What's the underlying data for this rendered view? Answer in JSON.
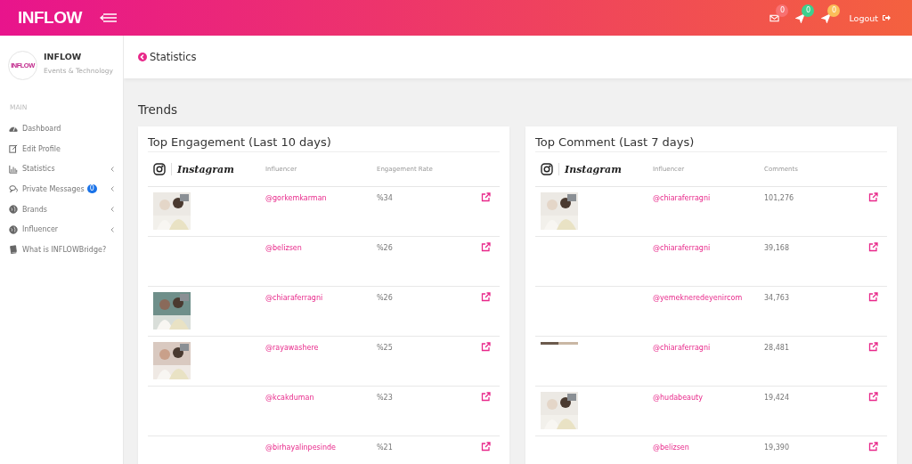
{
  "header": {
    "logo": "INFLOW",
    "notifications": [
      {
        "kind": "mail",
        "count": "0",
        "color": "#f87171"
      },
      {
        "kind": "send",
        "count": "0",
        "color": "#3ecf8e"
      },
      {
        "kind": "send",
        "count": "0",
        "color": "#fbbf5a"
      }
    ],
    "logout": "Logout"
  },
  "sidebar": {
    "profile": {
      "name": "INFLOW",
      "subtitle": "Events & Technology",
      "avatar_text": "INFLOW"
    },
    "section": "MAIN",
    "items": [
      {
        "label": "Dashboard",
        "kind": "dashboard",
        "has_submenu": false
      },
      {
        "label": "Edit Profile",
        "kind": "edit",
        "has_submenu": false
      },
      {
        "label": "Statistics",
        "kind": "chart",
        "has_submenu": true
      },
      {
        "label": "Private Messages",
        "kind": "chat",
        "has_submenu": true,
        "badge": "0"
      },
      {
        "label": "Brands",
        "kind": "globe",
        "has_submenu": true
      },
      {
        "label": "Influencer",
        "kind": "globe",
        "has_submenu": true
      },
      {
        "label": "What is INFLOWBridge?",
        "kind": "book",
        "has_submenu": false
      }
    ]
  },
  "page_title": "Statistics",
  "section_title": "Trends",
  "cards": [
    {
      "title": "Top Engagement (Last 10 days)",
      "platform": "Instagram",
      "columns": [
        "Influencer",
        "Engagement Rate"
      ],
      "rows": [
        {
          "kind": "picture",
          "handle": "@gorkemkarman",
          "value": "%34"
        },
        {
          "kind": "plain",
          "handle": "@belizsen",
          "value": "%26"
        },
        {
          "kind": "picture",
          "handle": "@chiaraferragni",
          "value": "%26"
        },
        {
          "kind": "picture",
          "handle": "@rayawashere",
          "value": "%25"
        },
        {
          "kind": "plain",
          "handle": "@kcakduman",
          "value": "%23"
        },
        {
          "kind": "plain",
          "handle": "@birhayalinpesinde",
          "value": "%21"
        }
      ]
    },
    {
      "title": "Top Comment (Last 7 days)",
      "platform": "Instagram",
      "columns": [
        "Influencer",
        "Comments"
      ],
      "rows": [
        {
          "kind": "picture",
          "handle": "@chiaraferragni",
          "value": "101,276"
        },
        {
          "kind": "plain",
          "handle": "@chiaraferragni",
          "value": "39,168"
        },
        {
          "kind": "plain",
          "handle": "@yemekneredeyenircom",
          "value": "34,763"
        },
        {
          "kind": "strip",
          "handle": "@chiaraferragni",
          "value": "28,481"
        },
        {
          "kind": "picture",
          "handle": "@hudabeauty",
          "value": "19,424"
        },
        {
          "kind": "plain",
          "handle": "@belizsen",
          "value": "19,390"
        }
      ]
    }
  ]
}
